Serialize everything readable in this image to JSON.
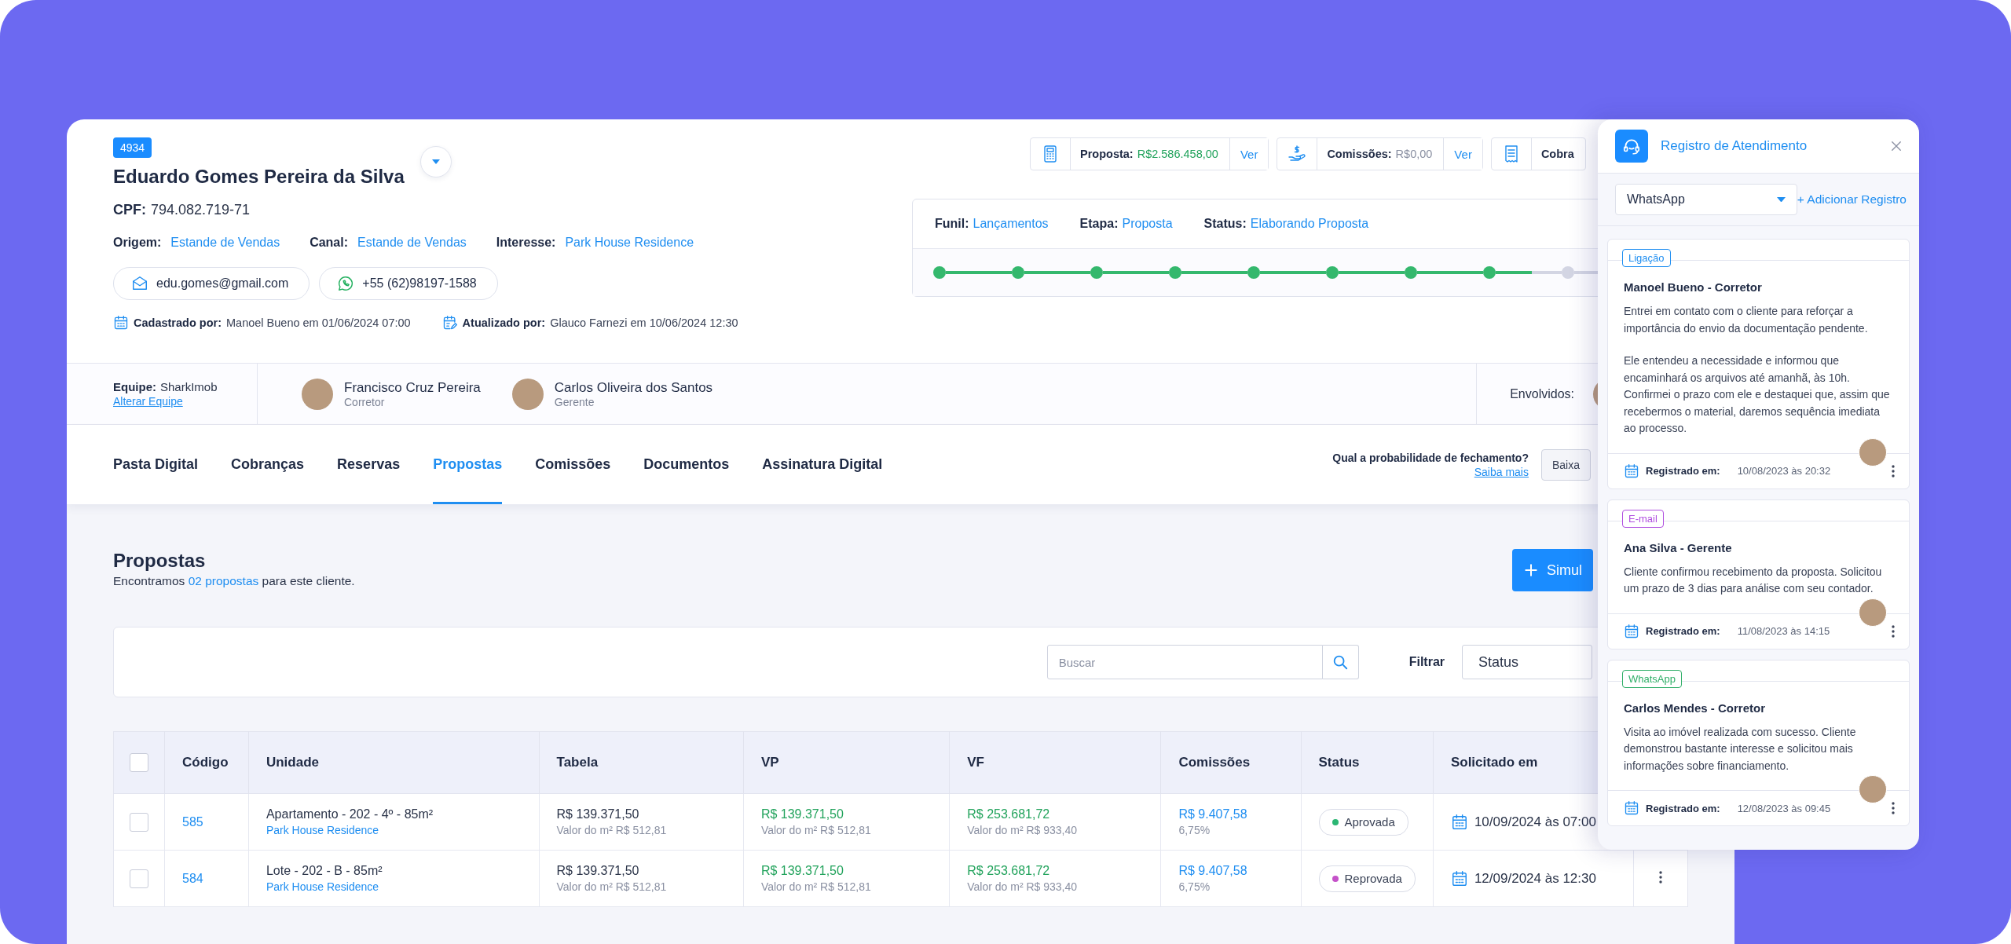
{
  "client": {
    "id_badge": "4934",
    "name": "Eduardo Gomes Pereira da Silva",
    "cpf_label": "CPF:",
    "cpf": "794.082.719-71",
    "attributes": [
      {
        "label": "Origem:",
        "value": "Estande de Vendas"
      },
      {
        "label": "Canal:",
        "value": "Estande de Vendas"
      },
      {
        "label": "Interesse:",
        "value": "Park House Residence"
      }
    ],
    "contacts": [
      {
        "kind": "email",
        "value": "edu.gomes@gmail.com"
      },
      {
        "kind": "whatsapp",
        "value": "+55 (62)98197-1588"
      }
    ],
    "audit": [
      {
        "kind": "created",
        "label": "Cadastrado por:",
        "value": "Manoel Bueno em 01/06/2024 07:00"
      },
      {
        "kind": "updated",
        "label": "Atualizado por:",
        "value": "Glauco Farnezi em 10/06/2024 12:30"
      }
    ]
  },
  "summary_chips": [
    {
      "kind": "proposal",
      "label": "Proposta:",
      "value": "R$2.586.458,00",
      "action": "Ver"
    },
    {
      "kind": "commission",
      "label": "Comissões:",
      "value": "R$0,00",
      "action": "Ver"
    },
    {
      "kind": "billing",
      "label": "Cobra"
    }
  ],
  "funnel": {
    "fields": [
      {
        "label": "Funil:",
        "value": "Lançamentos"
      },
      {
        "label": "Etapa:",
        "value": "Proposta"
      },
      {
        "label": "Status:",
        "value": "Elaborando Proposta"
      }
    ],
    "steps": [
      {
        "done": true
      },
      {
        "done": true
      },
      {
        "done": true
      },
      {
        "done": true
      },
      {
        "done": true
      },
      {
        "done": true
      },
      {
        "done": true
      },
      {
        "done": true
      },
      {
        "done": false
      }
    ]
  },
  "team": {
    "label": "Equipe:",
    "name": "SharkImob",
    "change_link": "Alterar Equipe",
    "members": [
      {
        "name": "Francisco Cruz Pereira",
        "role": "Corretor"
      },
      {
        "name": "Carlos Oliveira dos Santos",
        "role": "Gerente"
      }
    ],
    "involved_label": "Envolvidos:"
  },
  "tabs": [
    {
      "label": "Pasta Digital",
      "selected": false
    },
    {
      "label": "Cobranças",
      "selected": false
    },
    {
      "label": "Reservas",
      "selected": false
    },
    {
      "label": "Propostas",
      "selected": true
    },
    {
      "label": "Comissões",
      "selected": false
    },
    {
      "label": "Documentos",
      "selected": false
    },
    {
      "label": "Assinatura Digital",
      "selected": false
    }
  ],
  "closing_probability": {
    "question": "Qual a probabilidade de fechamento?",
    "link": "Saiba mais",
    "options": [
      {
        "label": "Baixa",
        "selected": false
      }
    ]
  },
  "proposals": {
    "title": "Propostas",
    "summary_before": "Encontramos",
    "summary_link": "02 propostas",
    "summary_after": "para este cliente.",
    "new_button": "Simul",
    "search": {
      "placeholder": "Buscar"
    },
    "filter_label": "Filtrar",
    "filter_select": "Status"
  },
  "table": {
    "select_all_checked": false,
    "columns": [
      "Código",
      "Unidade",
      "Tabela",
      "VP",
      "VF",
      "Comissões",
      "Status",
      "Solicitado em"
    ],
    "rows": [
      {
        "checked": false,
        "code": "585",
        "unit": "Apartamento - 202 - 4º - 85m²",
        "development": "Park House Residence",
        "table_price": "R$ 139.371,50",
        "table_m2": "Valor do m² R$ 512,81",
        "vp": "R$ 139.371,50",
        "vp_m2": "Valor do m² R$ 512,81",
        "vf": "R$ 253.681,72",
        "vf_m2": "Valor do m² R$ 933,40",
        "commission": "R$ 9.407,58",
        "commission_pct": "6,75%",
        "status": {
          "label": "Aprovada",
          "color": "#2bb673"
        },
        "requested": "10/09/2024 às 07:00"
      },
      {
        "checked": false,
        "code": "584",
        "unit": "Lote - 202 - B - 85m²",
        "development": "Park House Residence",
        "table_price": "R$ 139.371,50",
        "table_m2": "Valor do m² R$ 512,81",
        "vp": "R$ 139.371,50",
        "vp_m2": "Valor do m² R$ 512,81",
        "vf": "R$ 253.681,72",
        "vf_m2": "Valor do m² R$ 933,40",
        "commission": "R$ 9.407,58",
        "commission_pct": "6,75%",
        "status": {
          "label": "Reprovada",
          "color": "#c552c9"
        },
        "requested": "12/09/2024 às 12:30"
      }
    ]
  },
  "panel": {
    "title": "Registro de Atendimento",
    "channel_select": "WhatsApp",
    "add_link": "+ Adicionar Registro",
    "entries": [
      {
        "tag": "Ligação",
        "color": "#1f8ef1",
        "author": "Manoel Bueno - Corretor",
        "paragraphs": [
          "Entrei em contato com o cliente para reforçar a importância do envio da documentação pendente.",
          "Ele entendeu a necessidade e informou que encaminhará os arquivos até amanhã, às 10h. Confirmei o prazo com ele e destaquei que, assim que recebermos o material, daremos sequência imediata ao processo."
        ],
        "date_label": "Registrado em:",
        "date": "10/08/2023 às 20:32"
      },
      {
        "tag": "E-mail",
        "color": "#b04fe0",
        "author": "Ana Silva - Gerente",
        "paragraphs": [
          "Cliente confirmou recebimento da proposta. Solicitou um prazo de 3 dias para análise com seu contador."
        ],
        "date_label": "Registrado em:",
        "date": "11/08/2023 às 14:15"
      },
      {
        "tag": "WhatsApp",
        "color": "#2fae68",
        "author": "Carlos Mendes - Corretor",
        "paragraphs": [
          "Visita ao imóvel realizada com sucesso. Cliente demonstrou bastante interesse e solicitou mais informações sobre financiamento."
        ],
        "date_label": "Registrado em:",
        "date": "12/08/2023 às 09:45"
      }
    ]
  }
}
